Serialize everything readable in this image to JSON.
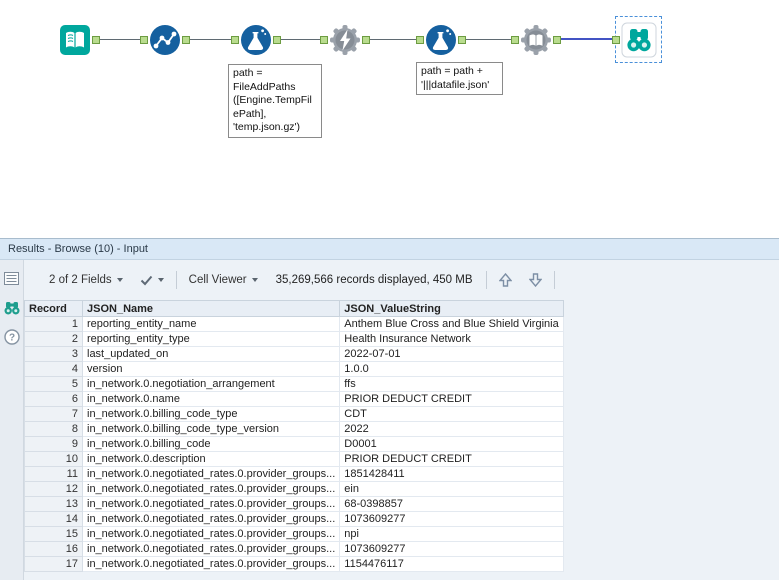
{
  "workflow": {
    "tools": [
      {
        "icon": "book-input-icon"
      },
      {
        "icon": "line-dots-icon"
      },
      {
        "icon": "flask-icon"
      },
      {
        "icon": "gear-lightning-icon"
      },
      {
        "icon": "flask-icon"
      },
      {
        "icon": "gear-book-icon"
      },
      {
        "icon": "binoculars-icon"
      }
    ],
    "annotations": [
      {
        "text": "path =\nFileAddPaths\n([Engine.TempFil\nePath],\n'temp.json.gz')"
      },
      {
        "text": "path = path +\n'|||datafile.json'"
      }
    ]
  },
  "results": {
    "header": "Results - Browse (10) - Input",
    "toolbar": {
      "fields_selector": "2 of 2 Fields",
      "cell_viewer": "Cell Viewer",
      "records_info": "35,269,566 records displayed, 450 MB"
    },
    "strip": {
      "help_glyph": "?"
    },
    "grid": {
      "columns": [
        "Record",
        "JSON_Name",
        "JSON_ValueString"
      ],
      "rows": [
        [
          "1",
          "reporting_entity_name",
          "Anthem Blue Cross and Blue Shield Virginia"
        ],
        [
          "2",
          "reporting_entity_type",
          "Health Insurance Network"
        ],
        [
          "3",
          "last_updated_on",
          "2022-07-01"
        ],
        [
          "4",
          "version",
          "1.0.0"
        ],
        [
          "5",
          "in_network.0.negotiation_arrangement",
          "ffs"
        ],
        [
          "6",
          "in_network.0.name",
          "PRIOR DEDUCT CREDIT"
        ],
        [
          "7",
          "in_network.0.billing_code_type",
          "CDT"
        ],
        [
          "8",
          "in_network.0.billing_code_type_version",
          "2022"
        ],
        [
          "9",
          "in_network.0.billing_code",
          "D0001"
        ],
        [
          "10",
          "in_network.0.description",
          "PRIOR DEDUCT CREDIT"
        ],
        [
          "11",
          "in_network.0.negotiated_rates.0.provider_groups...",
          "1851428411"
        ],
        [
          "12",
          "in_network.0.negotiated_rates.0.provider_groups...",
          "ein"
        ],
        [
          "13",
          "in_network.0.negotiated_rates.0.provider_groups...",
          "68-0398857"
        ],
        [
          "14",
          "in_network.0.negotiated_rates.0.provider_groups...",
          "1073609277"
        ],
        [
          "15",
          "in_network.0.negotiated_rates.0.provider_groups...",
          "npi"
        ],
        [
          "16",
          "in_network.0.negotiated_rates.0.provider_groups...",
          "1073609277"
        ],
        [
          "17",
          "in_network.0.negotiated_rates.0.provider_groups...",
          "1154476117"
        ]
      ]
    }
  },
  "colors": {
    "teal": "#00a79d",
    "tool_blue": "#15609f",
    "gear_gray": "#9aa1aa",
    "selection": "#4a90d9",
    "wire_selected": "#4353c4"
  }
}
